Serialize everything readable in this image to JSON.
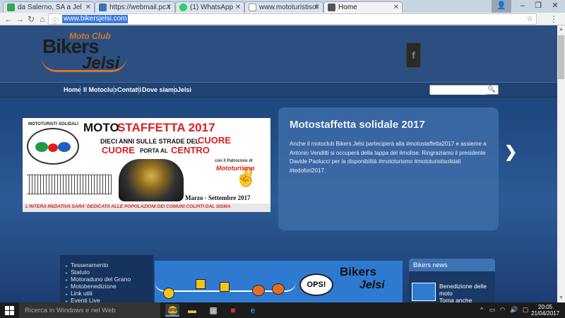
{
  "tabs": [
    {
      "label": "da Salerno, SA a Jel",
      "favicon_color": "#34a853"
    },
    {
      "label": "https://webmail.pc.t",
      "favicon_color": "#3b6fb6"
    },
    {
      "label": "(1) WhatsApp",
      "favicon_color": "#25d366"
    },
    {
      "label": "www.mototuristisol",
      "favicon_color": "#9aa0a6"
    },
    {
      "label": "Home",
      "favicon_color": "#555555"
    }
  ],
  "address_bar": {
    "url": "www.bikersjelsi.com"
  },
  "site": {
    "logo": {
      "top": "Moto Club",
      "name1": "Bikers",
      "name2": "Jelsi"
    },
    "facebook_glyph": "f",
    "nav": [
      "Home",
      "Il Motoclub",
      "Contatti",
      "Dove siamo",
      "Jelsi"
    ],
    "search": {
      "placeholder": ""
    },
    "slide": {
      "title": "Motostaffetta solidale 2017",
      "text": "Anche il motoclub Bikers Jelsi parteciperà alla #motostaffetta2017 e assieme a Antonio Venditti si occuperà della tappa del #molise. Ringraziamo il presidente Davide Paolucci per la disponibilità #mototurismo #mototuristisolidali #tedofori2017.",
      "image": {
        "heading_a": "MOTO",
        "heading_b": "STAFFETTA 2017",
        "brand": "MOTOTURISTI SOLIDALI",
        "line1a": "DIECI ANNI SULLE STRADE DEL",
        "line1b": "CUORE",
        "line2a": "CUORE",
        "line2b": "PORTA AL",
        "line2c": "CENTRO",
        "patronage": "con il Patrocinio di",
        "sponsor": "Mototurismo",
        "dates": "Marzo - Settembre 2017",
        "footer": "L'INTERA INIZIATIVA SARA' DEDICATA ALLE POPOLAZIONI DEI COMUNI COLPITI DAL SISMA"
      }
    },
    "side_menu": [
      "Tesseramento",
      "Statuto",
      "Motoraduno del Grano",
      "Motobenedizione",
      "Link utili",
      "Eventi Live"
    ],
    "banner": {
      "bubble": "OPS!",
      "name1": "Bikers",
      "name2": "Jelsi"
    },
    "news": {
      "header": "Bikers news",
      "title": "Benedizione delle moto",
      "subtitle": "Toma anche"
    }
  },
  "taskbar": {
    "search_placeholder": "Ricerca in Windows e nel Web",
    "time": "20:05",
    "date": "21/04/2017"
  },
  "colors": {
    "accent_orange": "#d9732a",
    "site_blue": "#1f4780",
    "panel_blue": "#3c6aa6"
  }
}
